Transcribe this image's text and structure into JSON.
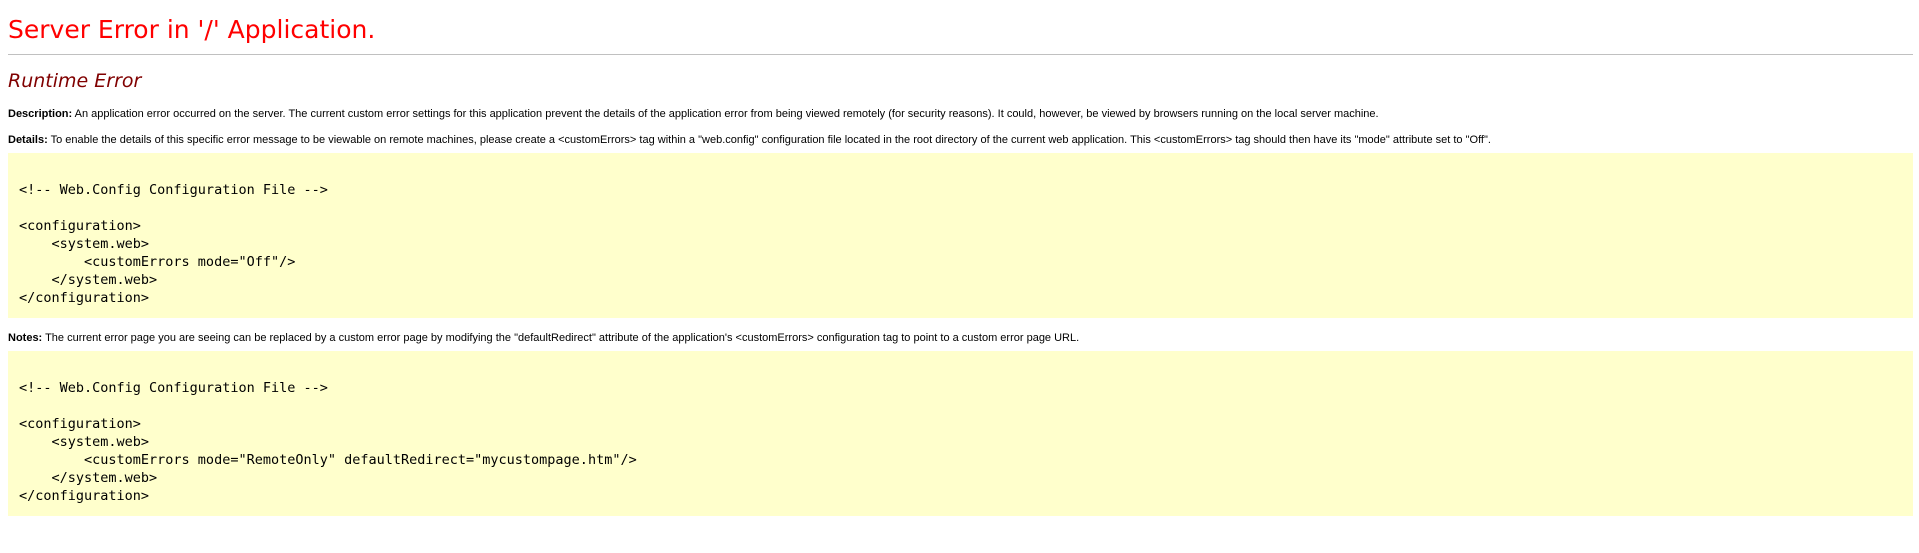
{
  "header": {
    "title": "Server Error in '/' Application.",
    "subtitle": "Runtime Error"
  },
  "description": {
    "label": "Description:",
    "text": " An application error occurred on the server. The current custom error settings for this application prevent the details of the application error from being viewed remotely (for security reasons). It could, however, be viewed by browsers running on the local server machine."
  },
  "details": {
    "label": "Details:",
    "text": " To enable the details of this specific error message to be viewable on remote machines, please create a <customErrors> tag within a \"web.config\" configuration file located in the root directory of the current web application. This <customErrors> tag should then have its \"mode\" attribute set to \"Off\"."
  },
  "code_block_1": "\n<!-- Web.Config Configuration File -->\n\n<configuration>\n    <system.web>\n        <customErrors mode=\"Off\"/>\n    </system.web>\n</configuration>",
  "notes": {
    "label": "Notes:",
    "text": " The current error page you are seeing can be replaced by a custom error page by modifying the \"defaultRedirect\" attribute of the application's <customErrors> configuration tag to point to a custom error page URL."
  },
  "code_block_2": "\n<!-- Web.Config Configuration File -->\n\n<configuration>\n    <system.web>\n        <customErrors mode=\"RemoteOnly\" defaultRedirect=\"mycustompage.htm\"/>\n    </system.web>\n</configuration>",
  "colors": {
    "title": "#ff0000",
    "subtitle": "#800000",
    "code_background": "#ffffcc",
    "rule": "#c0c0c0"
  }
}
